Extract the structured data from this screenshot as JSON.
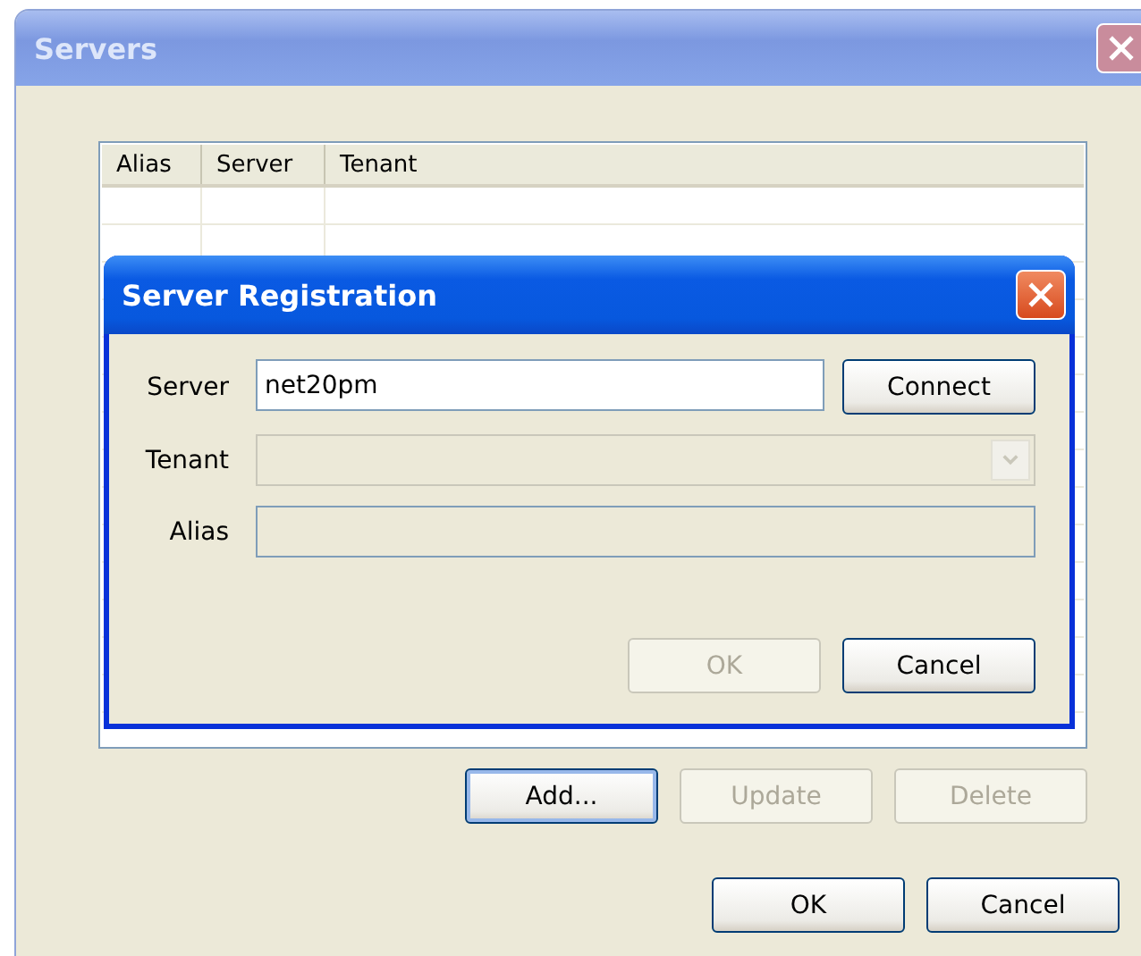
{
  "window": {
    "title": "Servers"
  },
  "table": {
    "columns": [
      "Alias",
      "Server",
      "Tenant"
    ]
  },
  "list_buttons": [
    {
      "label": "Add...",
      "disabled": false,
      "focused": true
    },
    {
      "label": "Update",
      "disabled": true,
      "focused": false
    },
    {
      "label": "Delete",
      "disabled": true,
      "focused": false
    }
  ],
  "dialog_buttons": [
    {
      "label": "OK",
      "disabled": false
    },
    {
      "label": "Cancel",
      "disabled": false
    }
  ],
  "dialog": {
    "title": "Server Registration",
    "fields": [
      {
        "kind": "text",
        "label": "Server",
        "value": "net20pm",
        "disabled": false,
        "button": "Connect"
      },
      {
        "kind": "combo",
        "label": "Tenant",
        "disabled": true
      },
      {
        "kind": "text",
        "label": "Alias",
        "disabled": true
      }
    ],
    "buttons": [
      {
        "label": "OK",
        "disabled": true
      },
      {
        "label": "Cancel",
        "disabled": false
      }
    ]
  }
}
